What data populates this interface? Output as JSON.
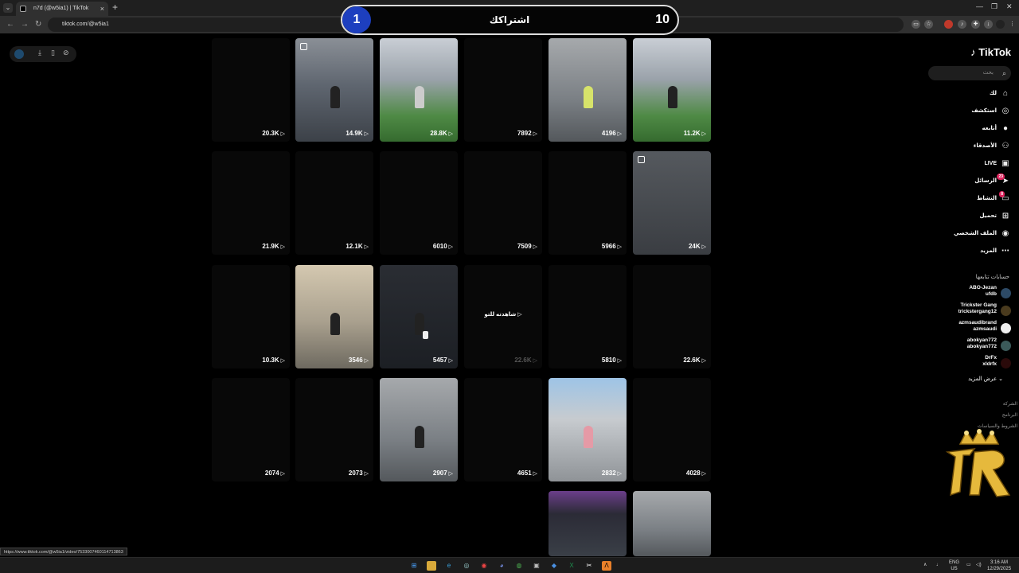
{
  "browser": {
    "tab_title": "n7d (@w5ia1) | TikTok",
    "tab_close": "×",
    "new_tab": "+",
    "url": "tiktok.com/@w5ia1",
    "status_url": "https://www.tiktok.com/@w5ia1/video/7533007460114713863"
  },
  "overlay": {
    "left_number": "1",
    "title": "اشتراكك",
    "right_number": "10"
  },
  "sidebar": {
    "logo": "TikTok",
    "search_placeholder": "بحث",
    "nav": [
      {
        "label": "لك",
        "icon": "home-icon"
      },
      {
        "label": "استكشف",
        "icon": "compass-icon"
      },
      {
        "label": "أتابعه",
        "icon": "following-avatar"
      },
      {
        "label": "الأصدقاء",
        "icon": "friends-icon"
      },
      {
        "label": "LIVE",
        "icon": "live-icon"
      },
      {
        "label": "الرسائل",
        "icon": "messages-icon",
        "badge": "23"
      },
      {
        "label": "النشاط",
        "icon": "activity-icon",
        "badge": "8"
      },
      {
        "label": "تحميل",
        "icon": "upload-icon"
      },
      {
        "label": "الملف الشخصي",
        "icon": "profile-icon"
      },
      {
        "label": "المزيد",
        "icon": "more-icon"
      }
    ],
    "following_header": "حسابات تتابعها",
    "accounts": [
      {
        "name": "ABO-Jezan",
        "handle": "ufdb"
      },
      {
        "name": "Trickster Gang",
        "handle": "trickstergang12"
      },
      {
        "name": "azmsaudibrand",
        "handle": "azmsaudi"
      },
      {
        "name": "abokyan772",
        "handle": "abokyan772"
      },
      {
        "name": "DrFx",
        "handle": "xldrfx"
      }
    ],
    "see_more": "عرض المزيد",
    "footer": [
      "الشركة",
      "البرنامج",
      "الشروط والسياسات"
    ]
  },
  "grid": {
    "watch_again": "شاهدته للتو",
    "tiles": [
      {
        "count": "20.3K"
      },
      {
        "count": "14.9K"
      },
      {
        "count": "28.8K"
      },
      {
        "count": "7892"
      },
      {
        "count": "4196"
      },
      {
        "count": "11.2K"
      },
      {
        "count": "21.9K"
      },
      {
        "count": "12.1K"
      },
      {
        "count": "6010"
      },
      {
        "count": "7509"
      },
      {
        "count": "5966"
      },
      {
        "count": "24K"
      },
      {
        "count": "10.3K"
      },
      {
        "count": "3546"
      },
      {
        "count": "5457"
      },
      {
        "count": "22.6K"
      },
      {
        "count": "5810"
      },
      {
        "count": "22.6K"
      },
      {
        "count": "2074"
      },
      {
        "count": "2073"
      },
      {
        "count": "2907"
      },
      {
        "count": "4651"
      },
      {
        "count": "2832"
      },
      {
        "count": "4028"
      }
    ]
  },
  "taskbar": {
    "lang": "ENG",
    "region": "US",
    "time": "3:16 AM",
    "date": "12/29/2025"
  }
}
